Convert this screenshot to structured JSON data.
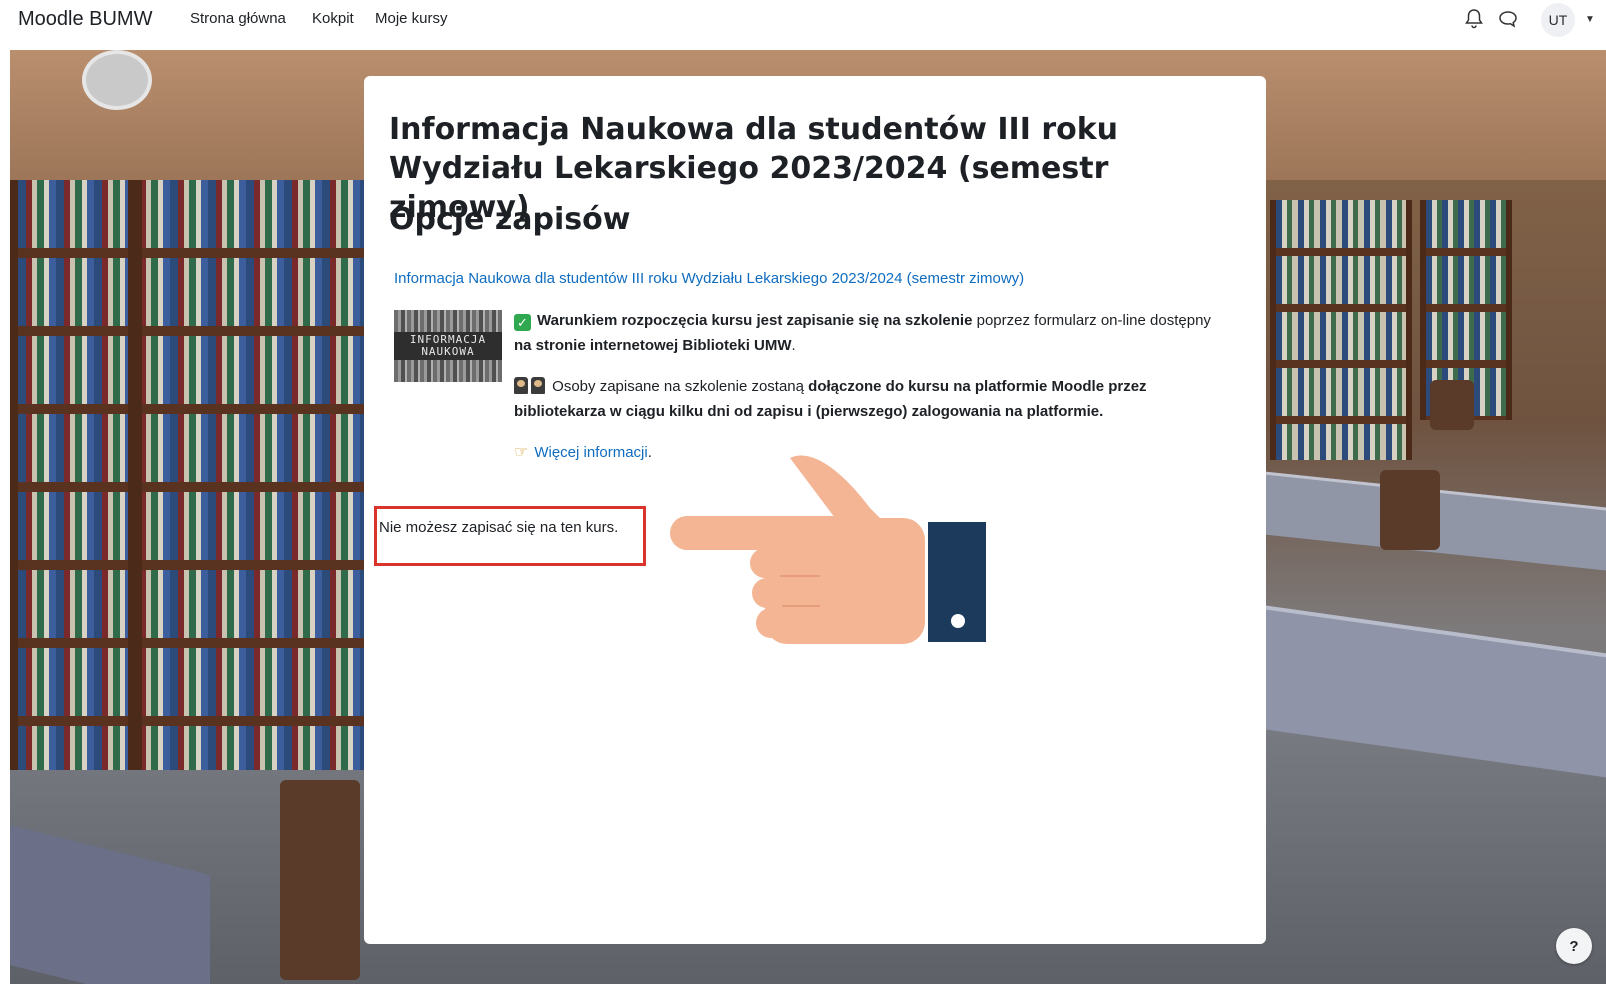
{
  "navbar": {
    "brand": "Moodle BUMW",
    "links": [
      "Strona główna",
      "Kokpit",
      "Moje kursy"
    ],
    "user_initials": "UT",
    "user_menu_caret": "chevron-down-icon",
    "icons": [
      "bell-icon",
      "chat-icon"
    ]
  },
  "card": {
    "course_title": "Informacja Naukowa dla studentów III roku Wydziału Lekarskiego 2023/2024 (semestr zimowy)",
    "page_heading": "Opcje zapisów",
    "course_link": "Informacja Naukowa dla studentów III roku Wydziału Lekarskiego 2023/2024 (semestr zimowy)",
    "course_image_text": "INFORMACJA NAUKOWA",
    "summary": {
      "p1_bold": "Warunkiem rozpoczęcia kursu jest zapisanie się na szkolenie",
      "p1_text": " poprzez formularz on-line dostępny ",
      "p1_bold2": "na stronie internetowej Biblioteki UMW",
      "p1_end": ".",
      "p2_text": "Osoby zapisane na szkolenie zostaną ",
      "p2_bold": "dołączone do kursu na platformie Moodle przez bibliotekarza w ciągu kilku dni od zapisu i (pierwszego) zalogowania na platformie.",
      "p3_link": "Więcej informacji",
      "p3_end": "."
    },
    "notice": "Nie możesz zapisać się na ten kurs."
  },
  "help_button": "?",
  "colors": {
    "link": "#0f6cbf",
    "highlight_border": "#d9342b",
    "hand_skin": "#f4b594",
    "sleeve": "#1b3a5c"
  }
}
